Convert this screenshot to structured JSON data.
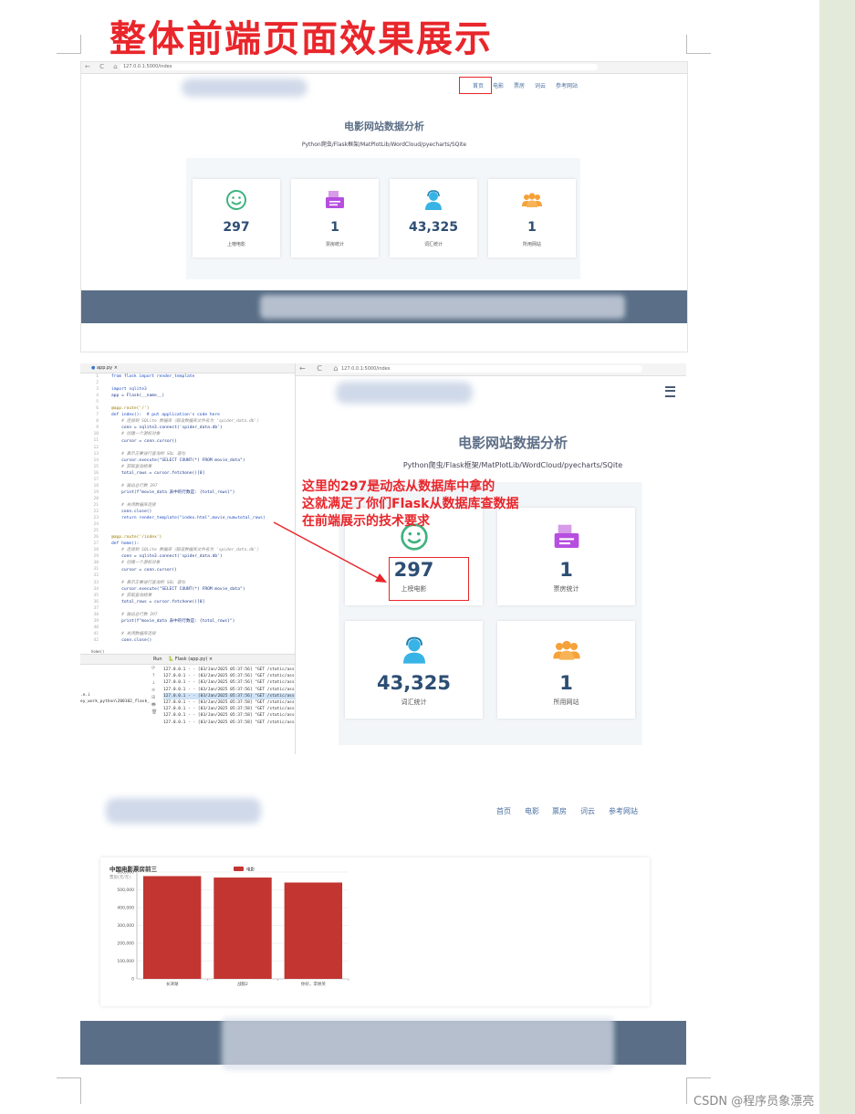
{
  "doc": {
    "title": "整体前端页面效果展示",
    "watermark": "CSDN @程序员象漂亮"
  },
  "site": {
    "nav": [
      "首页",
      "电影",
      "票房",
      "词云",
      "参考网站"
    ],
    "heading": "电影网站数据分析",
    "subheading": "Python爬虫/Flask框架/MatPlotLib/WordCloud/pyecharts/SQite",
    "url_small": "127.0.0.1:5000/index",
    "url_large": "127.0.0.1:5000/index",
    "stats": [
      {
        "icon": "smiley-icon",
        "value": "297",
        "label": "上榜电影",
        "color": "#3fb27f"
      },
      {
        "icon": "document-icon",
        "value": "1",
        "label": "票房统计",
        "color": "#b64ee0"
      },
      {
        "icon": "support-agent-icon",
        "value": "43,325",
        "label": "词汇统计",
        "color": "#38b3e6"
      },
      {
        "icon": "users-icon",
        "value": "1",
        "label": "所用网站",
        "color": "#f5a23a"
      }
    ]
  },
  "ide": {
    "tab": "app.py",
    "run_tab": "Run",
    "run_config": "Flask (app.py)",
    "status_fn": "home()",
    "line_numbers": [
      "1",
      "2",
      "3",
      "4",
      "5",
      "6",
      "7",
      "8",
      "9",
      "10",
      "11",
      "12",
      "13",
      "14",
      "15",
      "16",
      "17",
      "18",
      "19",
      "20",
      "21",
      "22",
      "23",
      "24",
      "25",
      "26",
      "27",
      "28",
      "29",
      "30",
      "31",
      "32",
      "33",
      "34",
      "35",
      "36",
      "37",
      "38",
      "39",
      "40",
      "41",
      "42"
    ],
    "code": [
      "from flask import render_template",
      "",
      "import sqlite3",
      "app = Flask(__name__)",
      "",
      "@app.route('/')",
      "def index():  # put application's code here",
      "    # 连接到 SQLite 数据库（假设数据库文件名为 'spider_data.db'）",
      "    conn = sqlite3.connect('spider_data.db')",
      "    # 创建一个游标对象",
      "    cursor = conn.cursor()",
      "",
      "    # 表示正要进行查询的 SQL 语句",
      "    cursor.execute(\"SELECT COUNT(*) FROM movie_data\")",
      "    # 获取查询结果",
      "    total_rows = cursor.fetchone()[0]",
      "",
      "    # 输出总行数 297",
      "    print(f\"movie_data 表中的行数是: {total_rows}\")",
      "",
      "    # 关闭数据库连接",
      "    conn.close()",
      "    return render_template(\"index.html\",movie_num=total_rows)",
      "",
      "",
      "@app.route('/index')",
      "def home():",
      "    # 连接到 SQLite 数据库（假设数据库文件名为 'spider_data.db'）",
      "    conn = sqlite3.connect('spider_data.db')",
      "    # 创建一个游标对象",
      "    cursor = conn.cursor()",
      "",
      "    # 表示正要进行查询的 SQL 语句",
      "    cursor.execute(\"SELECT COUNT(*) FROM movie_data\")",
      "    # 获取查询结果",
      "    total_rows = cursor.fetchone()[0]",
      "",
      "    # 输出总行数 297",
      "    print(f\"movie_data 表中的行数是: {total_rows}\")",
      "",
      "    # 关闭数据库连接",
      "    conn.close()"
    ],
    "console_left": [
      ".e.i",
      "ey_work_python\\200102_flask_"
    ],
    "console": [
      "127.0.0.1 - - [03/Jan/2025 05:37:56] \"GET /static/assets",
      "127.0.0.1 - - [03/Jan/2025 05:37:56] \"GET /static/assets",
      "127.0.0.1 - - [03/Jan/2025 05:37:56] \"GET /static/assets",
      "127.0.0.1 - - [03/Jan/2025 05:37:56] \"GET /static/assets",
      "127.0.0.1 - - [03/Jan/2025 05:37:56] \"GET /static/assets",
      "127.0.0.1 - - [03/Jan/2025 05:37:58] \"GET /static/assets",
      "127.0.0.1 - - [03/Jan/2025 05:37:58] \"GET /static/assets",
      "127.0.0.1 - - [03/Jan/2025 05:37:58] \"GET /static/assets",
      "127.0.0.1 - - [03/Jan/2025 05:37:58] \"GET /static/assets"
    ]
  },
  "annotation": {
    "lines": [
      "这里的297是动态从数据库中拿的",
      "这就满足了你们Flask从数据库查数据",
      "在前端展示的技术要求"
    ],
    "color": "#e8262b"
  },
  "chart_data": {
    "type": "bar",
    "title": "中国电影票房前三",
    "subtitle": "票房(元/元)",
    "legend": [
      "电影"
    ],
    "legend_position": "top-center",
    "categories": [
      "长津湖",
      "战狼2",
      "你好，李焕英"
    ],
    "series": [
      {
        "name": "电影",
        "values": [
          577000,
          569000,
          541000
        ]
      }
    ],
    "ylim": [
      0,
      600000
    ],
    "yticks": [
      "0",
      "100,000",
      "200,000",
      "300,000",
      "400,000",
      "500,000",
      "600,000"
    ],
    "ytick_values": [
      0,
      100000,
      200000,
      300000,
      400000,
      500000,
      600000
    ],
    "grid": true,
    "bar_color": "#c23531"
  }
}
